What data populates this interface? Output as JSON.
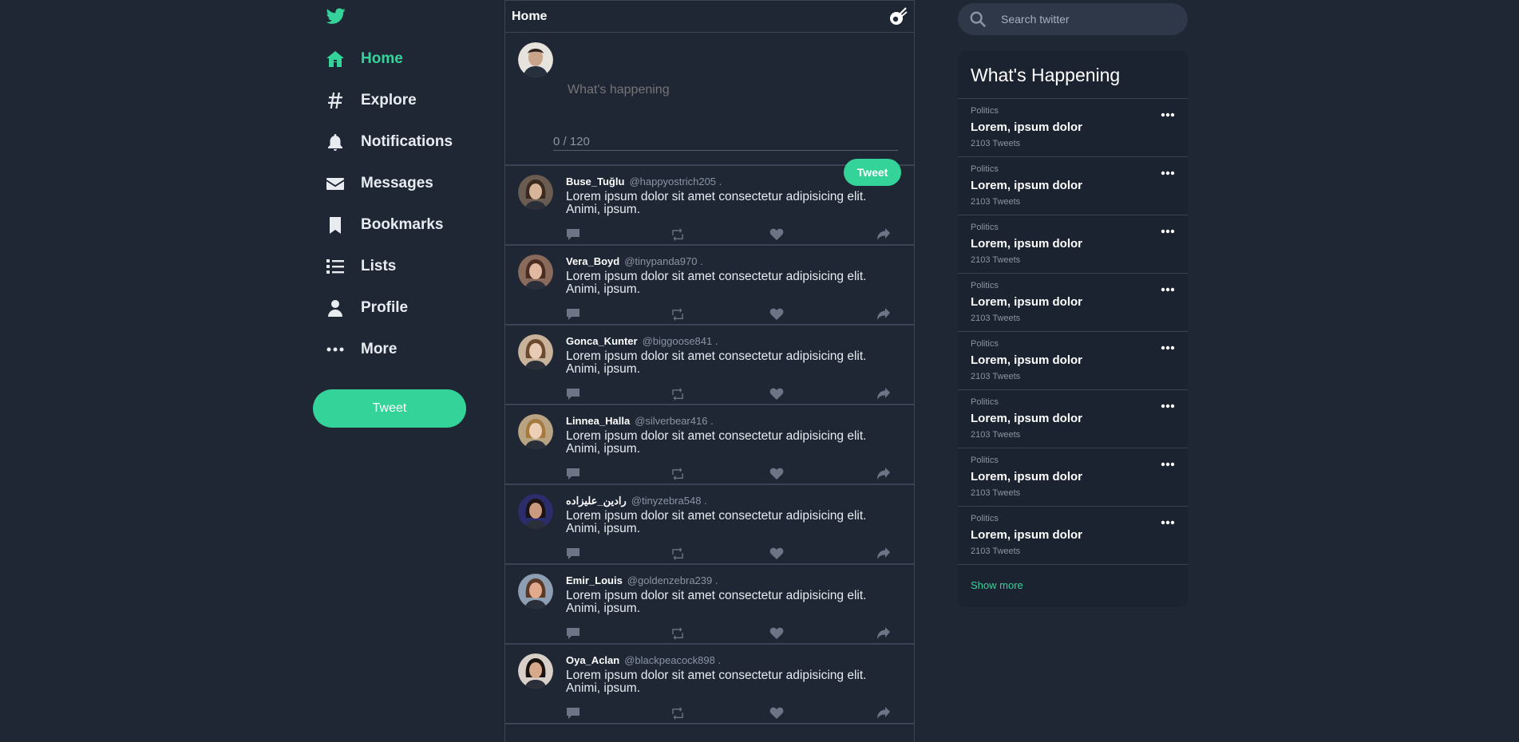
{
  "theme": {
    "accent": "#34d399",
    "background": "#1f2735",
    "border": "#3a4454"
  },
  "sidebar": {
    "logo_icon": "twitter-bird-icon",
    "items": [
      {
        "label": "Home",
        "icon": "home-icon",
        "active": true
      },
      {
        "label": "Explore",
        "icon": "hashtag-icon"
      },
      {
        "label": "Notifications",
        "icon": "bell-icon"
      },
      {
        "label": "Messages",
        "icon": "envelope-icon"
      },
      {
        "label": "Bookmarks",
        "icon": "bookmark-icon"
      },
      {
        "label": "Lists",
        "icon": "list-icon"
      },
      {
        "label": "Profile",
        "icon": "user-icon"
      },
      {
        "label": "More",
        "icon": "ellipsis-icon"
      }
    ],
    "tweet_label": "Tweet"
  },
  "feed": {
    "title": "Home",
    "composer": {
      "placeholder": "What's happening",
      "counter": "0 / 120",
      "tweet_label": "Tweet"
    },
    "tweets": [
      {
        "name": "Buse_Tuğlu",
        "handle": "@happyostrich205 .",
        "text": "Lorem ipsum dolor sit amet consectetur adipisicing elit. Animi, ipsum."
      },
      {
        "name": "Vera_Boyd",
        "handle": "@tinypanda970 .",
        "text": "Lorem ipsum dolor sit amet consectetur adipisicing elit. Animi, ipsum."
      },
      {
        "name": "Gonca_Kunter",
        "handle": "@biggoose841 .",
        "text": "Lorem ipsum dolor sit amet consectetur adipisicing elit. Animi, ipsum."
      },
      {
        "name": "Linnea_Halla",
        "handle": "@silverbear416 .",
        "text": "Lorem ipsum dolor sit amet consectetur adipisicing elit. Animi, ipsum."
      },
      {
        "name": "رادین_علیزاده",
        "handle": "@tinyzebra548 .",
        "text": "Lorem ipsum dolor sit amet consectetur adipisicing elit. Animi, ipsum."
      },
      {
        "name": "Emir_Louis",
        "handle": "@goldenzebra239 .",
        "text": "Lorem ipsum dolor sit amet consectetur adipisicing elit. Animi, ipsum."
      },
      {
        "name": "Oya_Aclan",
        "handle": "@blackpeacock898 .",
        "text": "Lorem ipsum dolor sit amet consectetur adipisicing elit. Animi, ipsum."
      }
    ]
  },
  "right": {
    "search_placeholder": "Search twitter",
    "trends_title": "What's Happening",
    "trends": [
      {
        "category": "Politics",
        "topic": "Lorem, ipsum dolor",
        "count": "2103 Tweets"
      },
      {
        "category": "Politics",
        "topic": "Lorem, ipsum dolor",
        "count": "2103 Tweets"
      },
      {
        "category": "Politics",
        "topic": "Lorem, ipsum dolor",
        "count": "2103 Tweets"
      },
      {
        "category": "Politics",
        "topic": "Lorem, ipsum dolor",
        "count": "2103 Tweets"
      },
      {
        "category": "Politics",
        "topic": "Lorem, ipsum dolor",
        "count": "2103 Tweets"
      },
      {
        "category": "Politics",
        "topic": "Lorem, ipsum dolor",
        "count": "2103 Tweets"
      },
      {
        "category": "Politics",
        "topic": "Lorem, ipsum dolor",
        "count": "2103 Tweets"
      },
      {
        "category": "Politics",
        "topic": "Lorem, ipsum dolor",
        "count": "2103 Tweets"
      }
    ],
    "show_more": "Show more"
  }
}
